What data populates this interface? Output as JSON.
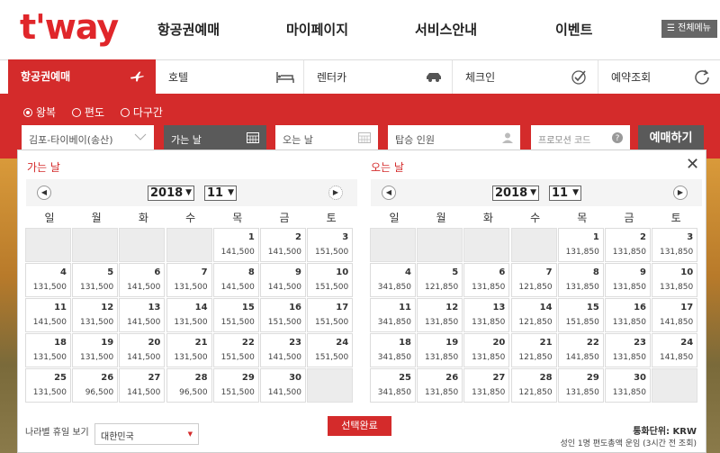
{
  "header": {
    "logo": "t'way",
    "nav": [
      "항공권예매",
      "마이페이지",
      "서비스안내",
      "이벤트"
    ],
    "all_menu": "☰ 전체메뉴"
  },
  "tabs": [
    {
      "label": "항공권예매",
      "icon": "airplane-icon",
      "active": true
    },
    {
      "label": "호텔",
      "icon": "bed-icon",
      "active": false
    },
    {
      "label": "렌터카",
      "icon": "car-icon",
      "active": false
    },
    {
      "label": "체크인",
      "icon": "check-icon",
      "active": false
    },
    {
      "label": "예약조회",
      "icon": "refresh-icon",
      "active": false
    }
  ],
  "booking": {
    "trip_types": [
      {
        "label": "왕복",
        "selected": true
      },
      {
        "label": "편도",
        "selected": false
      },
      {
        "label": "다구간",
        "selected": false
      }
    ],
    "route": "김포-타이베이(송산)",
    "depart_placeholder": "가는 날",
    "return_placeholder": "오는 날",
    "passengers_placeholder": "탑승 인원",
    "promo_placeholder": "프로모션 코드",
    "book_button": "예매하기"
  },
  "calendar": {
    "depart_title": "가는 날",
    "return_title": "오는 날",
    "weekdays": [
      "일",
      "월",
      "화",
      "수",
      "목",
      "금",
      "토"
    ],
    "depart": {
      "year": "2018",
      "month": "11",
      "first_weekday": 4,
      "days": [
        [
          "1",
          "141,500"
        ],
        [
          "2",
          "141,500"
        ],
        [
          "3",
          "151,500"
        ],
        [
          "4",
          "131,500"
        ],
        [
          "5",
          "131,500"
        ],
        [
          "6",
          "141,500"
        ],
        [
          "7",
          "131,500"
        ],
        [
          "8",
          "141,500"
        ],
        [
          "9",
          "141,500"
        ],
        [
          "10",
          "151,500"
        ],
        [
          "11",
          "141,500"
        ],
        [
          "12",
          "131,500"
        ],
        [
          "13",
          "141,500"
        ],
        [
          "14",
          "131,500"
        ],
        [
          "15",
          "151,500"
        ],
        [
          "16",
          "151,500"
        ],
        [
          "17",
          "151,500"
        ],
        [
          "18",
          "131,500"
        ],
        [
          "19",
          "131,500"
        ],
        [
          "20",
          "141,500"
        ],
        [
          "21",
          "131,500"
        ],
        [
          "22",
          "151,500"
        ],
        [
          "23",
          "141,500"
        ],
        [
          "24",
          "151,500"
        ],
        [
          "25",
          "131,500"
        ],
        [
          "26",
          "96,500"
        ],
        [
          "27",
          "141,500"
        ],
        [
          "28",
          "96,500"
        ],
        [
          "29",
          "151,500"
        ],
        [
          "30",
          "141,500"
        ]
      ]
    },
    "return": {
      "year": "2018",
      "month": "11",
      "first_weekday": 4,
      "days": [
        [
          "1",
          "131,850"
        ],
        [
          "2",
          "131,850"
        ],
        [
          "3",
          "131,850"
        ],
        [
          "4",
          "341,850"
        ],
        [
          "5",
          "121,850"
        ],
        [
          "6",
          "131,850"
        ],
        [
          "7",
          "121,850"
        ],
        [
          "8",
          "131,850"
        ],
        [
          "9",
          "131,850"
        ],
        [
          "10",
          "131,850"
        ],
        [
          "11",
          "341,850"
        ],
        [
          "12",
          "131,850"
        ],
        [
          "13",
          "131,850"
        ],
        [
          "14",
          "121,850"
        ],
        [
          "15",
          "151,850"
        ],
        [
          "16",
          "131,850"
        ],
        [
          "17",
          "141,850"
        ],
        [
          "18",
          "341,850"
        ],
        [
          "19",
          "131,850"
        ],
        [
          "20",
          "131,850"
        ],
        [
          "21",
          "121,850"
        ],
        [
          "22",
          "141,850"
        ],
        [
          "23",
          "131,850"
        ],
        [
          "24",
          "141,850"
        ],
        [
          "25",
          "341,850"
        ],
        [
          "26",
          "131,850"
        ],
        [
          "27",
          "131,850"
        ],
        [
          "28",
          "121,850"
        ],
        [
          "29",
          "131,850"
        ],
        [
          "30",
          "131,850"
        ]
      ]
    },
    "holiday_label": "나라별 휴일 보기",
    "country": "대한민국",
    "done_button": "선택완료",
    "currency_unit": "통화단위: KRW",
    "fare_note": "성인 1명 편도총액 운임 (3시간 전 조회)"
  },
  "colors": {
    "brand": "#d42b2b",
    "dark_button": "#5a5a5a"
  }
}
